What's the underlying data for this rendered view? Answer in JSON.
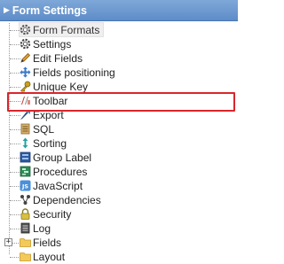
{
  "header": {
    "title": "Form Settings",
    "toggle_icon": "triangle-right-icon"
  },
  "tree": {
    "items": [
      {
        "label": "Form Formats",
        "icon": "gear-icon",
        "selected": true
      },
      {
        "label": "Settings",
        "icon": "gear-icon"
      },
      {
        "label": "Edit Fields",
        "icon": "pencil-icon"
      },
      {
        "label": "Fields positioning",
        "icon": "move-arrows-icon"
      },
      {
        "label": "Unique Key",
        "icon": "key-icon"
      },
      {
        "label": "Toolbar",
        "icon": "toolbar-icon",
        "highlighted": true
      },
      {
        "label": "Export",
        "icon": "export-icon"
      },
      {
        "label": "SQL",
        "icon": "sql-icon"
      },
      {
        "label": "Sorting",
        "icon": "sort-arrows-icon"
      },
      {
        "label": "Group Label",
        "icon": "group-label-icon"
      },
      {
        "label": "Procedures",
        "icon": "procedures-icon"
      },
      {
        "label": "JavaScript",
        "icon": "javascript-icon"
      },
      {
        "label": "Dependencies",
        "icon": "dependencies-icon"
      },
      {
        "label": "Security",
        "icon": "lock-icon"
      },
      {
        "label": "Log",
        "icon": "log-icon"
      },
      {
        "label": "Fields",
        "icon": "folder-icon",
        "expander": "+"
      },
      {
        "label": "Layout",
        "icon": "folder-icon"
      }
    ]
  },
  "colors": {
    "header_bg": "#6a96cf",
    "highlight_border": "#d9262c",
    "selected_bg": "#efefef"
  }
}
